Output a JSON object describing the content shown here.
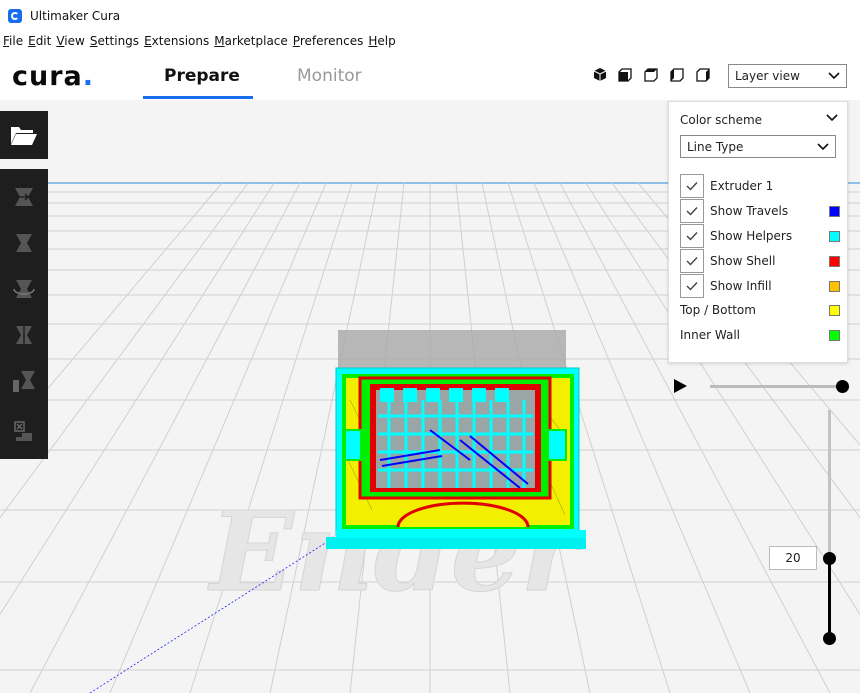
{
  "window": {
    "title": "Ultimaker Cura"
  },
  "menu": [
    "File",
    "Edit",
    "View",
    "Settings",
    "Extensions",
    "Marketplace",
    "Preferences",
    "Help"
  ],
  "header": {
    "logo": "cura",
    "tabs": [
      {
        "label": "Prepare",
        "active": true
      },
      {
        "label": "Monitor",
        "active": false
      }
    ],
    "view_buttons": [
      "3d-view-icon",
      "front-view-icon",
      "top-view-icon",
      "left-view-icon",
      "right-view-icon"
    ],
    "view_mode": "Layer view"
  },
  "left_toolbar": {
    "open_icon": "folder-open-icon",
    "tools": [
      "move-tool-icon",
      "scale-tool-icon",
      "rotate-tool-icon",
      "mirror-tool-icon",
      "per-model-settings-icon",
      "support-blocker-icon"
    ]
  },
  "color_panel": {
    "label": "Color scheme",
    "selected_scheme": "Line Type",
    "checkbox_items": [
      {
        "label": "Extruder 1",
        "checked": true,
        "color": ""
      },
      {
        "label": "Show Travels",
        "checked": true,
        "color": "#0000ff"
      },
      {
        "label": "Show Helpers",
        "checked": true,
        "color": "#00ffff"
      },
      {
        "label": "Show Shell",
        "checked": true,
        "color": "#ff0000"
      },
      {
        "label": "Show Infill",
        "checked": true,
        "color": "#ffc000"
      }
    ],
    "legend_items": [
      {
        "label": "Top / Bottom",
        "color": "#ffff00"
      },
      {
        "label": "Inner Wall",
        "color": "#00ff00"
      }
    ]
  },
  "layer": {
    "current": "20",
    "playback_icon": "play-icon"
  },
  "colors": {
    "accent": "#196ef0",
    "toolbar": "#1e1e1e"
  }
}
